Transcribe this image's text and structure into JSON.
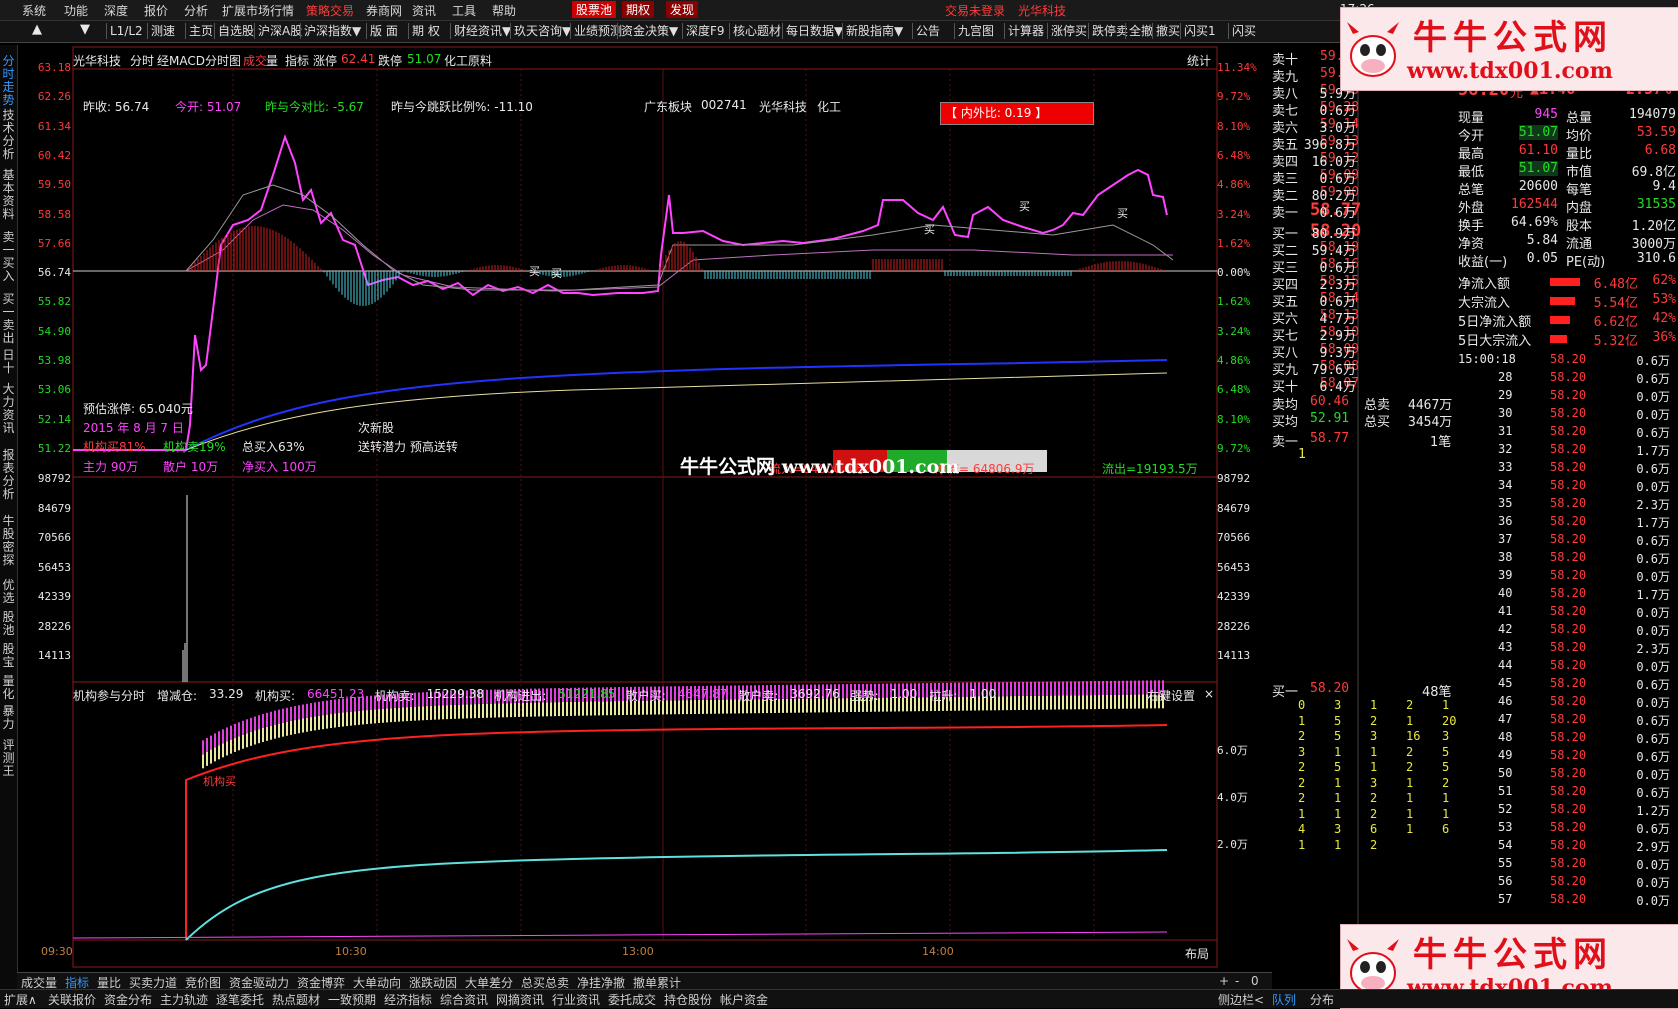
{
  "menubar": {
    "items": [
      "系统",
      "功能",
      "深度",
      "报价",
      "分析",
      "扩展市场行情",
      "策略交易",
      "券商网",
      "资讯",
      "工具",
      "帮助"
    ],
    "highlight": [
      "股票池",
      "期权",
      "发现"
    ],
    "status": "交易未登录",
    "stock_name": "光华科技",
    "clock": "17:26"
  },
  "toolbar": {
    "items": [
      "L1/L2",
      "测速",
      "主页",
      "自选股",
      "沪深A股",
      "沪深指数▼",
      "版 面",
      "期 权",
      "财经资讯▼",
      "玖天咨询▼",
      "业绩预测",
      "资金决策▼",
      "深度F9",
      "核心题材",
      "每日数据▼",
      "新股指南▼",
      "公告",
      "九宫图",
      "计算器",
      "涨停买",
      "跌停卖",
      "全撤",
      "撤买",
      "闪买1",
      "闪买"
    ]
  },
  "left_tabs": [
    "分时走势",
    "技术分析",
    "基本资料",
    "卖一买入",
    "买一卖出",
    "日十",
    "大力资讯",
    "报表分析",
    "牛股密探",
    "优选",
    "股池",
    "股宝",
    "量化",
    "暴力",
    "评测王"
  ],
  "chart_header": {
    "stock": "光华科技",
    "mode": "分时",
    "indicator": "经MACD分时图",
    "label_vol": "成交",
    "label_vol2": "量",
    "label_idx": "指标",
    "zt_label": "涨停",
    "zt_value": "62.41",
    "dt_label": "跌停",
    "dt_value": "51.07",
    "sector": "化工原料",
    "stats": "统计"
  },
  "info_line": {
    "prev_close": "昨收: 56.74",
    "open": "今开: 51.07",
    "open_vs_prev": "昨与今对比: -5.67",
    "jump_ratio": "昨与今跳跃比例%: -11.10",
    "board": "广东板块",
    "code": "002741",
    "name": "光华科技",
    "industry": "化工",
    "inner_outer": "【 内外比: 0.19 】"
  },
  "annotations": {
    "est_zt": "预估涨停: 65.040元",
    "date": "2015 年 8 月 7 日",
    "inst_buy": "机构买81%",
    "inst_sell": "机构卖19%",
    "total_buy": "总买入63%",
    "main": "主力 90万",
    "retail": "散户 10万",
    "net_buy": "净买入 100万",
    "new_stock": "次新股",
    "potential": "送转潜力 预高送转",
    "inflow": "流入=84000.4万",
    "net_flow": "净流= 64806.9万",
    "outflow": "流出=19193.5万",
    "buy_tag": "买",
    "watermark_mid": "牛牛公式网 www.tdx001.com"
  },
  "price_axis": {
    "left": [
      "63.18",
      "62.26",
      "61.34",
      "60.42",
      "59.50",
      "58.58",
      "57.66",
      "56.74",
      "55.82",
      "54.90",
      "53.98",
      "53.06",
      "52.14",
      "51.22"
    ],
    "right": [
      "11.34%",
      "9.72%",
      "8.10%",
      "6.48%",
      "4.86%",
      "3.24%",
      "1.62%",
      "0.00%",
      "1.62%",
      "3.24%",
      "4.86%",
      "6.48%",
      "8.10%",
      "9.72%"
    ]
  },
  "volume_axis": [
    "98792",
    "84679",
    "70566",
    "56453",
    "42339",
    "28226",
    "14113"
  ],
  "lower_panel": {
    "title": "机构参与分时",
    "items": [
      {
        "label": "增减仓:",
        "value": "33.29",
        "color": "#e8e8e8"
      },
      {
        "label": "机构买:",
        "value": "66451.23",
        "color": "#ff44ff"
      },
      {
        "label": "机构卖:",
        "value": "15229.38",
        "color": "#e8e8e8"
      },
      {
        "label": "机构进出:",
        "value": "51221.85",
        "color": "#22dd22"
      },
      {
        "label": "散户买:",
        "value": "4647.87",
        "color": "#ff44ff"
      },
      {
        "label": "散户卖:",
        "value": "3692.76",
        "color": "#e8e8e8"
      },
      {
        "label": "强势:",
        "value": "1.00",
        "color": "#e8e8e8"
      },
      {
        "label": "拉升:",
        "value": "1.00",
        "color": "#e8e8e8"
      }
    ],
    "settings": "右键设置",
    "axis": [
      "6.0万",
      "4.0万",
      "2.0万"
    ],
    "tag": "机构买"
  },
  "time_axis": [
    "09:30",
    "10:30",
    "13:00",
    "14:00"
  ],
  "layout_label": "布局",
  "order_book": {
    "sell": [
      {
        "label": "卖十",
        "price": "59.",
        "vol": ""
      },
      {
        "label": "卖九",
        "price": "59.",
        "vol": ""
      },
      {
        "label": "卖八",
        "price": "59.45",
        "vol": "5.9万"
      },
      {
        "label": "卖七",
        "price": "59.28",
        "vol": "0.6万"
      },
      {
        "label": "卖六",
        "price": "59.14",
        "vol": "3.0万"
      },
      {
        "label": "卖五",
        "price": "59.13",
        "vol": "396.8万"
      },
      {
        "label": "卖四",
        "price": "59.12",
        "vol": "16.0万"
      },
      {
        "label": "卖三",
        "price": "59.09",
        "vol": "0.6万"
      },
      {
        "label": "卖二",
        "price": "59.00",
        "vol": "80.2万"
      },
      {
        "label": "卖一",
        "price": "58.77",
        "vol": "0.6万"
      }
    ],
    "buy": [
      {
        "label": "买一",
        "price": "58.20",
        "vol": "80.9万"
      },
      {
        "label": "买二",
        "price": "58.19",
        "vol": "59.4万"
      },
      {
        "label": "买三",
        "price": "58.16",
        "vol": "0.6万"
      },
      {
        "label": "买四",
        "price": "58.15",
        "vol": "2.3万"
      },
      {
        "label": "买五",
        "price": "58.14",
        "vol": "0.6万"
      },
      {
        "label": "买六",
        "price": "58.13",
        "vol": "4.7万"
      },
      {
        "label": "买七",
        "price": "58.10",
        "vol": "2.9万"
      },
      {
        "label": "买八",
        "price": "58.09",
        "vol": "9.3万"
      },
      {
        "label": "买九",
        "price": "58.08",
        "vol": "79.6万"
      },
      {
        "label": "买十",
        "price": "58.07",
        "vol": "6.4万"
      }
    ],
    "sell_avg_label": "卖均",
    "sell_avg": "60.46",
    "total_sell_label": "总卖",
    "total_sell": "4467万",
    "buy_avg_label": "买均",
    "buy_avg": "52.91",
    "total_buy_label": "总买",
    "total_buy": "3454万",
    "queue_sell_label": "卖一",
    "queue_sell_price": "58.77",
    "queue_sell_count": "1笔",
    "queue_sell_first": "1",
    "queue_buy_label": "买一",
    "queue_buy_price": "58.20",
    "queue_buy_count": "48笔",
    "queue_buy_rows": [
      [
        "0",
        "3",
        "1",
        "2",
        "1"
      ],
      [
        "1",
        "5",
        "2",
        "1",
        "20"
      ],
      [
        "2",
        "5",
        "3",
        "16",
        "3"
      ],
      [
        "3",
        "1",
        "1",
        "2",
        "5"
      ],
      [
        "2",
        "5",
        "1",
        "2",
        "5"
      ],
      [
        "2",
        "1",
        "3",
        "1",
        "2"
      ],
      [
        "2",
        "1",
        "2",
        "1",
        "1"
      ],
      [
        "1",
        "1",
        "2",
        "1",
        "1"
      ],
      [
        "4",
        "3",
        "6",
        "1",
        "6"
      ],
      [
        "1",
        "1",
        "2",
        "",
        ""
      ]
    ]
  },
  "quote": {
    "price": "58.20",
    "unit": "元",
    "change": "▲1.46",
    "pct": "2.57%",
    "rows": [
      {
        "l1": "现量",
        "v1": "945",
        "l2": "总量",
        "v2": "194079",
        "c1": "#ff44ff",
        "c2": "#e8e8e8"
      },
      {
        "l1": "今开",
        "v1": "51.07",
        "l2": "均价",
        "v2": "53.59",
        "c1": "#22dd22",
        "c2": "#ff3b3b"
      },
      {
        "l1": "最高",
        "v1": "61.10",
        "l2": "量比",
        "v2": "6.68",
        "c1": "#ff3b3b",
        "c2": "#ff3b3b"
      },
      {
        "l1": "最低",
        "v1": "51.07",
        "l2": "市值",
        "v2": "69.8亿",
        "c1": "#22dd22",
        "c2": "#e8e8e8"
      },
      {
        "l1": "总笔",
        "v1": "20600",
        "l2": "每笔",
        "v2": "9.4",
        "c1": "#e8e8e8",
        "c2": "#e8e8e8"
      },
      {
        "l1": "外盘",
        "v1": "162544",
        "l2": "内盘",
        "v2": "31535",
        "c1": "#ff3b3b",
        "c2": "#22dd22"
      },
      {
        "l1": "换手",
        "v1": "64.69%",
        "l2": "股本",
        "v2": "1.20亿",
        "c1": "#e8e8e8",
        "c2": "#e8e8e8"
      },
      {
        "l1": "净资",
        "v1": "5.84",
        "l2": "流通",
        "v2": "3000万",
        "c1": "#e8e8e8",
        "c2": "#e8e8e8"
      },
      {
        "l1": "收益(一)",
        "v1": "0.05",
        "l2": "PE(动)",
        "v2": "310.6",
        "c1": "#e8e8e8",
        "c2": "#e8e8e8"
      }
    ],
    "flows": [
      {
        "label": "净流入额",
        "value": "6.48亿",
        "pct": "62%",
        "fill": 0.62
      },
      {
        "label": "大宗流入",
        "value": "5.54亿",
        "pct": "53%",
        "fill": 0.53
      },
      {
        "label": "5日净流入额",
        "value": "6.62亿",
        "pct": "42%",
        "fill": 0.42
      },
      {
        "label": "5日大宗流入",
        "value": "5.32亿",
        "pct": "36%",
        "fill": 0.36
      }
    ]
  },
  "ticks": {
    "first_time": "15:00:18",
    "price": "58.20",
    "rows": [
      {
        "t": "",
        "v": "0.6万"
      },
      {
        "t": "28",
        "v": "0.6万"
      },
      {
        "t": "29",
        "v": "0.0万"
      },
      {
        "t": "30",
        "v": "0.0万"
      },
      {
        "t": "31",
        "v": "0.6万"
      },
      {
        "t": "32",
        "v": "1.7万"
      },
      {
        "t": "33",
        "v": "0.6万"
      },
      {
        "t": "34",
        "v": "0.0万"
      },
      {
        "t": "35",
        "v": "2.3万"
      },
      {
        "t": "36",
        "v": "1.7万"
      },
      {
        "t": "37",
        "v": "0.6万"
      },
      {
        "t": "38",
        "v": "0.6万"
      },
      {
        "t": "39",
        "v": "0.0万"
      },
      {
        "t": "40",
        "v": "1.7万"
      },
      {
        "t": "41",
        "v": "0.0万"
      },
      {
        "t": "42",
        "v": "0.0万"
      },
      {
        "t": "43",
        "v": "2.3万"
      },
      {
        "t": "44",
        "v": "0.0万"
      },
      {
        "t": "45",
        "v": "0.6万"
      },
      {
        "t": "46",
        "v": "0.0万"
      },
      {
        "t": "47",
        "v": "0.6万"
      },
      {
        "t": "48",
        "v": "0.6万"
      },
      {
        "t": "49",
        "v": "0.6万"
      },
      {
        "t": "50",
        "v": "0.0万"
      },
      {
        "t": "51",
        "v": "0.6万"
      },
      {
        "t": "52",
        "v": "1.2万"
      },
      {
        "t": "53",
        "v": "0.6万"
      },
      {
        "t": "54",
        "v": "2.9万"
      },
      {
        "t": "55",
        "v": "0.0万"
      },
      {
        "t": "56",
        "v": "0.0万"
      },
      {
        "t": "57",
        "v": "0.0万"
      }
    ]
  },
  "bottom_tabs_1": [
    "成交量",
    "指标",
    "量比",
    "买卖力道",
    "竞价图",
    "资金驱动力",
    "资金博弈",
    "大单动向",
    "涨跌动因",
    "大单差分",
    "总买总卖",
    "净挂净撤",
    "撤单累计"
  ],
  "bottom_tabs_2": [
    "扩展∧",
    "关联报价",
    "资金分布",
    "主力轨迹",
    "逐笔委托",
    "热点题材",
    "一致预期",
    "经济指标",
    "综合资讯",
    "网摘资讯",
    "行业资讯",
    "委托成交",
    "持仓股份",
    "帐户资金"
  ],
  "bottom_right": [
    "+",
    "-",
    "0",
    "侧边栏<",
    "队列",
    "分布"
  ],
  "watermark": {
    "title": "牛牛公式网",
    "url": "www.tdx001.com"
  }
}
